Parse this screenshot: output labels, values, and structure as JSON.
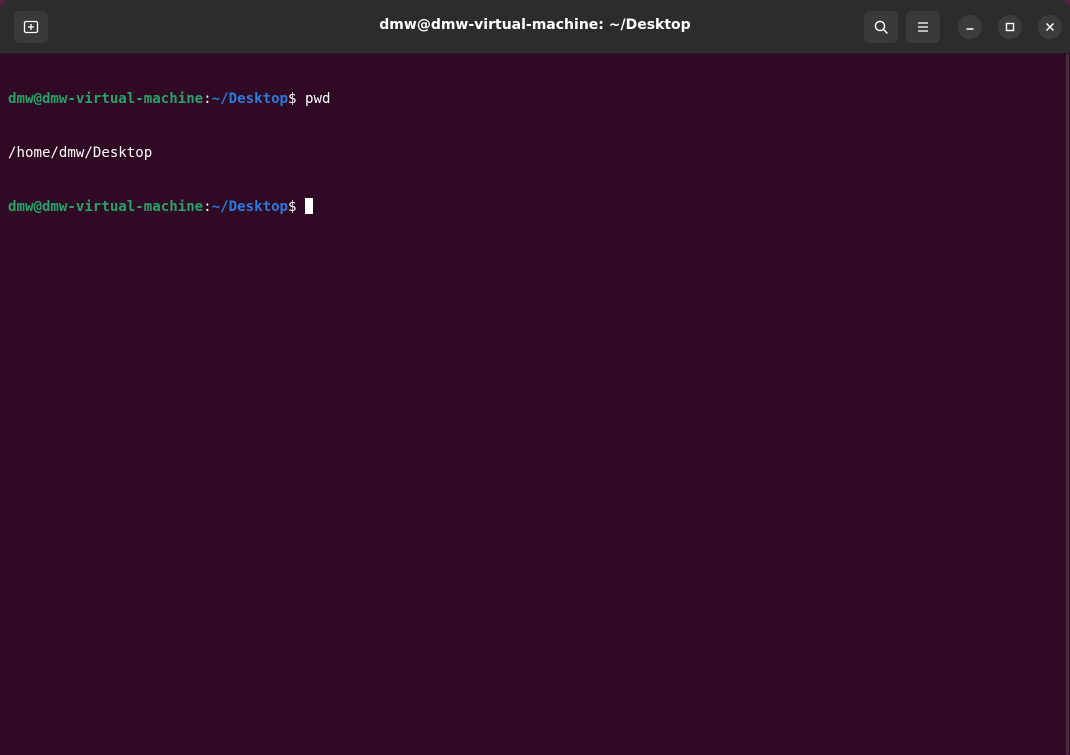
{
  "window": {
    "title": "dmw@dmw-virtual-machine: ~/Desktop"
  },
  "header": {
    "new_tab_icon": "new-tab-icon",
    "search_icon": "search-icon",
    "menu_icon": "hamburger-menu-icon",
    "minimize_icon": "minimize-icon",
    "maximize_icon": "maximize-icon",
    "close_icon": "close-icon"
  },
  "terminal": {
    "lines": [
      {
        "user_host": "dmw@dmw-virtual-machine",
        "colon": ":",
        "path": "~/Desktop",
        "prompt": "$ ",
        "command": "pwd"
      },
      {
        "output": "/home/dmw/Desktop"
      },
      {
        "user_host": "dmw@dmw-virtual-machine",
        "colon": ":",
        "path": "~/Desktop",
        "prompt": "$ ",
        "command": ""
      }
    ]
  },
  "colors": {
    "background": "#300a24",
    "titlebar": "#2c2c2c",
    "user_host": "#26a269",
    "path": "#2a7bde",
    "text": "#ffffff"
  }
}
